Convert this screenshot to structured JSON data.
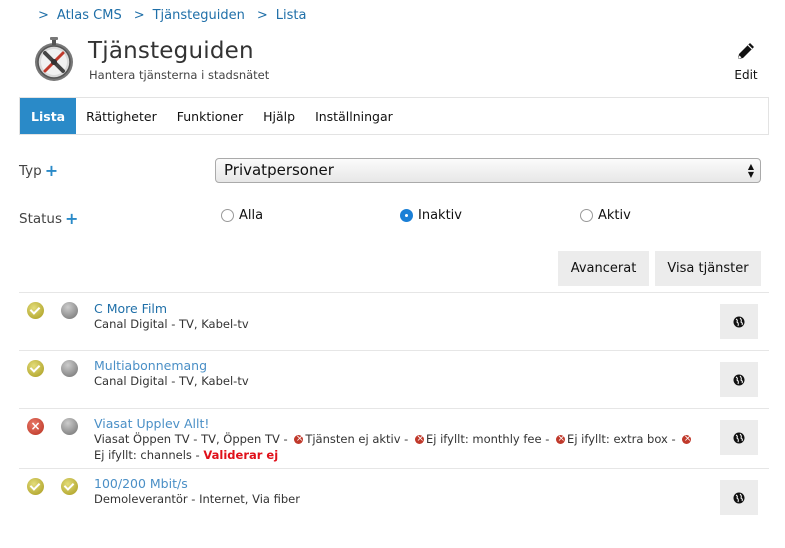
{
  "breadcrumb": [
    {
      "sep": ">",
      "label": "Atlas CMS"
    },
    {
      "sep": ">",
      "label": "Tjänsteguiden"
    },
    {
      "sep": ">",
      "label": "Lista"
    }
  ],
  "header": {
    "title": "Tjänsteguiden",
    "subtitle": "Hantera tjänsterna i stadsnätet",
    "edit_label": "Edit"
  },
  "tabs": [
    {
      "label": "Lista",
      "active": true
    },
    {
      "label": "Rättigheter"
    },
    {
      "label": "Funktioner"
    },
    {
      "label": "Hjälp"
    },
    {
      "label": "Inställningar"
    }
  ],
  "filters": {
    "type_label": "Typ",
    "type_value": "Privatpersoner",
    "status_label": "Status",
    "status_options": [
      {
        "label": "Alla",
        "checked": false
      },
      {
        "label": "Inaktiv",
        "checked": true
      },
      {
        "label": "Aktiv",
        "checked": false
      }
    ]
  },
  "buttons": {
    "advanced": "Avancerat",
    "show_services": "Visa tjänster"
  },
  "services": [
    {
      "status1": "ok",
      "status2": "grey",
      "title": "C More Film",
      "subtitle": "Canal Digital - TV, Kabel-tv"
    },
    {
      "status1": "ok",
      "status2": "grey",
      "title": "Multiabonnemang",
      "subtitle": "Canal Digital - TV, Kabel-tv"
    },
    {
      "status1": "error",
      "status2": "grey",
      "title": "Viasat Upplev Allt!",
      "subtitle_prefix": "Viasat Öppen TV - TV, Öppen TV -",
      "warnings": [
        "Tjänsten ej aktiv -",
        "Ej ifyllt: monthly fee -",
        "Ej ifyllt: extra box -",
        "Ej ifyllt:"
      ],
      "subtitle_suffix": "channels -",
      "invalid_label": "Validerar ej"
    },
    {
      "status1": "ok",
      "status2": "ok",
      "title": "100/200 Mbit/s",
      "subtitle": "Demoleverantör - Internet, Via fiber"
    }
  ]
}
